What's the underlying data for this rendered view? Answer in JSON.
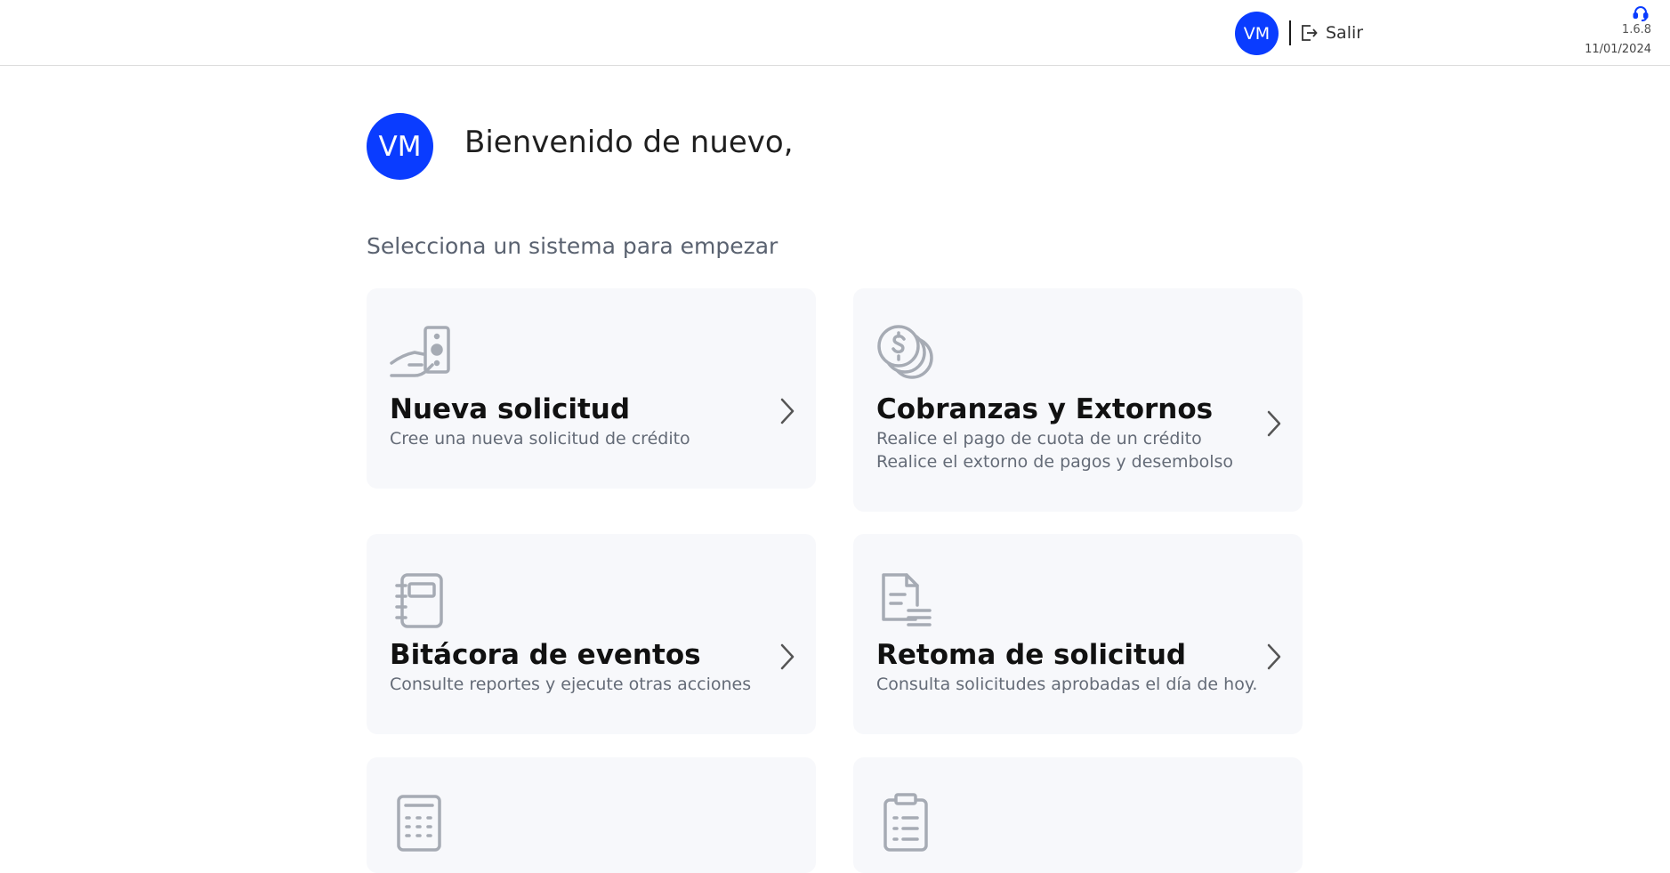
{
  "header": {
    "avatar_initials": "VM",
    "logout_label": "Salir",
    "version": "1.6.8",
    "date": "11/01/2024"
  },
  "welcome": {
    "avatar_initials": "VM",
    "greeting": "Bienvenido de nuevo,",
    "prompt": "Selecciona un sistema para empezar"
  },
  "cards": [
    {
      "title": "Nueva solicitud",
      "desc1": "Cree una nueva solicitud de crédito",
      "desc2": "",
      "icon": "cash-hand-icon"
    },
    {
      "title": "Cobranzas y Extornos",
      "desc1": "Realice el pago de cuota de un crédito",
      "desc2": "Realice el extorno de pagos y desembolso",
      "icon": "coins-icon"
    },
    {
      "title": "Bitácora de eventos",
      "desc1": "Consulte reportes y ejecute otras acciones",
      "desc2": "",
      "icon": "notebook-icon"
    },
    {
      "title": "Retoma de solicitud",
      "desc1": "Consulta solicitudes aprobadas el día de hoy.",
      "desc2": "",
      "icon": "document-list-icon"
    },
    {
      "title": "",
      "desc1": "",
      "desc2": "",
      "icon": "calculator-icon"
    },
    {
      "title": "",
      "desc1": "",
      "desc2": "",
      "icon": "clipboard-list-icon"
    }
  ],
  "colors": {
    "accent": "#0a3cff",
    "card_bg": "#f7f8fb",
    "icon_gray": "#a6abb4"
  }
}
